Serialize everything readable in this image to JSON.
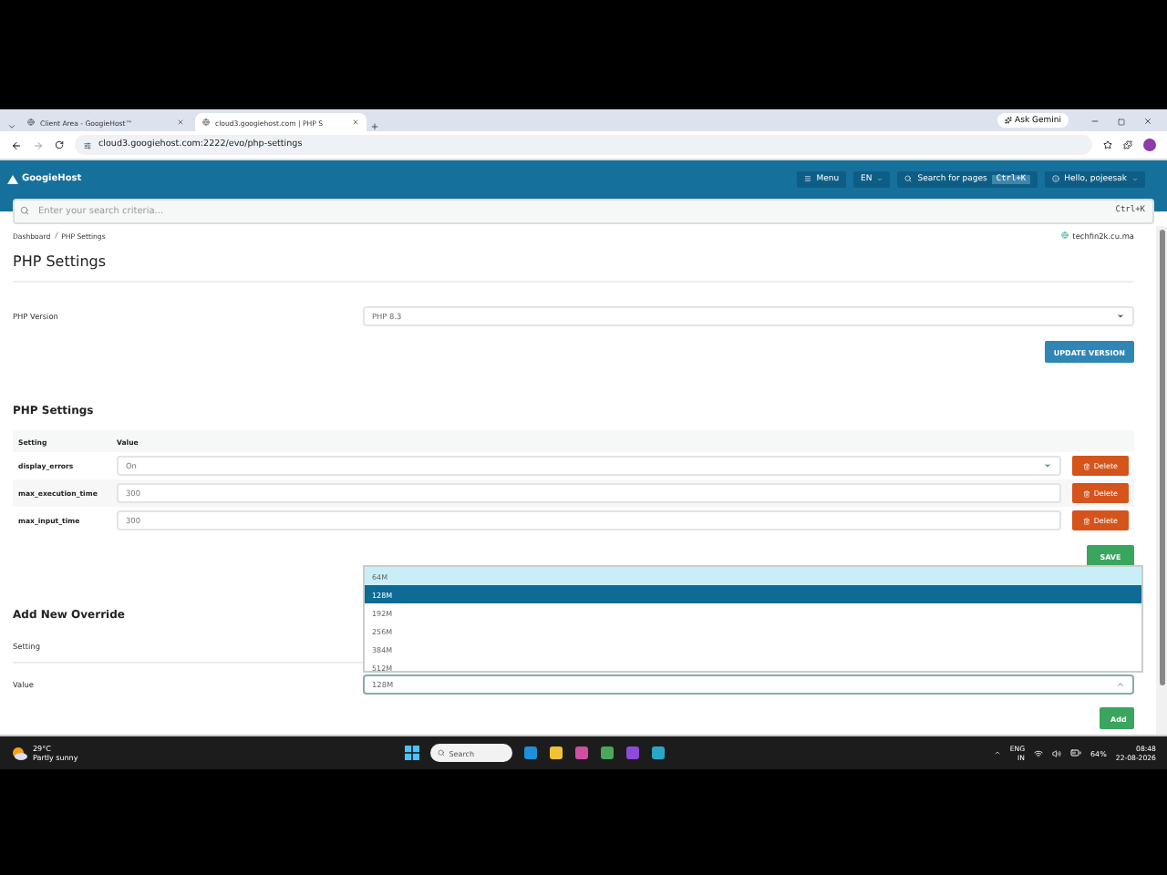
{
  "browser": {
    "tabs": [
      {
        "title": "Client Area - GoogieHost™",
        "selected": false
      },
      {
        "title": "cloud3.googiehost.com | PHP S",
        "selected": true
      }
    ],
    "ask_button": "Ask Gemini",
    "url": "cloud3.googiehost.com:2222/evo/php-settings"
  },
  "header": {
    "logo": "GoogieHost",
    "menu": "Menu",
    "language": "EN",
    "search_pages": "Search for pages",
    "shortcut": "Ctrl+K",
    "user": "Hello, pojeesak"
  },
  "search": {
    "placeholder": "Enter your search criteria...",
    "shortcut": "Ctrl+K"
  },
  "breadcrumb": [
    "Dashboard",
    "PHP Settings"
  ],
  "domain": "techfin2k.cu.ma",
  "page_title": "PHP Settings",
  "version": {
    "label": "PHP Version",
    "value": "PHP 8.3",
    "button": "UPDATE VERSION"
  },
  "settings": {
    "title": "PHP Settings",
    "columns": [
      "Setting",
      "Value"
    ],
    "rows": [
      {
        "name": "display_errors",
        "kind": "select",
        "value": "On",
        "button": "Delete"
      },
      {
        "name": "max_execution_time",
        "kind": "input",
        "value": "300",
        "button": "Delete"
      },
      {
        "name": "max_input_time",
        "kind": "input",
        "value": "300",
        "button": "Delete"
      }
    ],
    "save": "SAVE"
  },
  "override": {
    "title": "Add New Override",
    "setting_label": "Setting",
    "value_label": "Value",
    "value": "128M",
    "open": true,
    "options": [
      {
        "label": "64M",
        "highlighted": true,
        "selected": false
      },
      {
        "label": "128M",
        "highlighted": false,
        "selected": true
      },
      {
        "label": "192M",
        "highlighted": false,
        "selected": false
      },
      {
        "label": "256M",
        "highlighted": false,
        "selected": false
      },
      {
        "label": "384M",
        "highlighted": false,
        "selected": false
      },
      {
        "label": "512M",
        "highlighted": false,
        "selected": false
      }
    ],
    "button": "Add"
  },
  "taskbar": {
    "temperature": "29°C",
    "weather": "Partly sunny",
    "search": "Search",
    "language": [
      "ENG",
      "IN"
    ],
    "battery": "64%",
    "time": "08:48",
    "date": "22-08-2026"
  }
}
